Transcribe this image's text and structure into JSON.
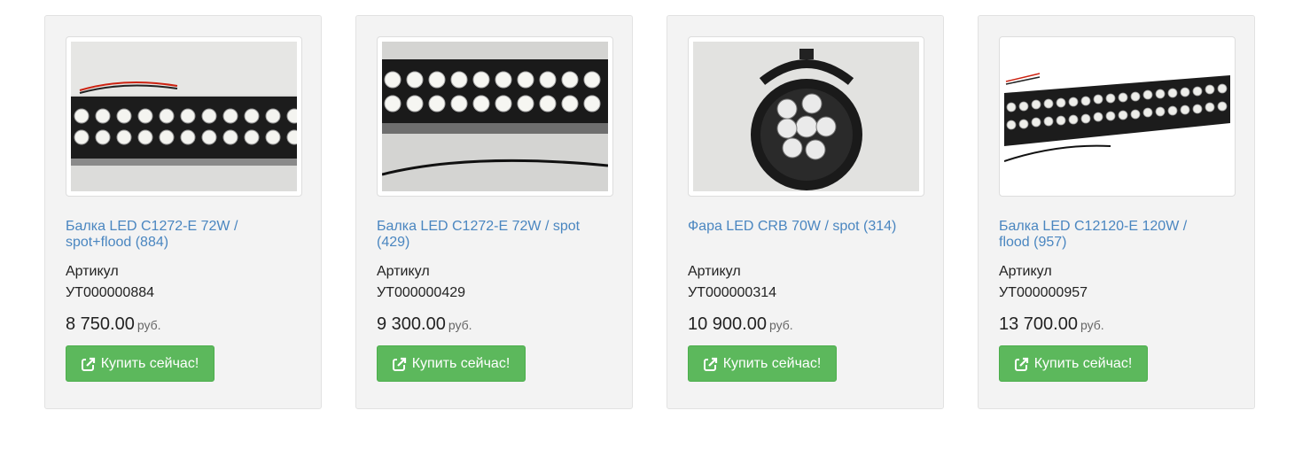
{
  "products": [
    {
      "title": "Балка LED C1272-E 72W / spot+flood (884)",
      "sku_label": "Артикул",
      "sku": "УТ000000884",
      "price": "8 750.00",
      "currency": "руб.",
      "button_label": "Купить сейчас!",
      "image_icon": "led-light-bar-photo"
    },
    {
      "title": "Балка LED C1272-E 72W / spot (429)",
      "sku_label": "Артикул",
      "sku": "УТ000000429",
      "price": "9 300.00",
      "currency": "руб.",
      "button_label": "Купить сейчас!",
      "image_icon": "led-light-bar-photo"
    },
    {
      "title": "Фара LED CRB 70W / spot (314)",
      "sku_label": "Артикул",
      "sku": "УТ000000314",
      "price": "10 900.00",
      "currency": "руб.",
      "button_label": "Купить сейчас!",
      "image_icon": "led-round-headlight-photo"
    },
    {
      "title": "Балка LED C12120-E 120W / flood (957)",
      "sku_label": "Артикул",
      "sku": "УТ000000957",
      "price": "13 700.00",
      "currency": "руб.",
      "button_label": "Купить сейчас!",
      "image_icon": "led-light-bar-photo"
    }
  ],
  "colors": {
    "card_bg": "#f3f3f3",
    "title_link": "#4a86c0",
    "button_bg": "#5cb85c",
    "text": "#222222"
  },
  "button_icon": "share-square-icon"
}
